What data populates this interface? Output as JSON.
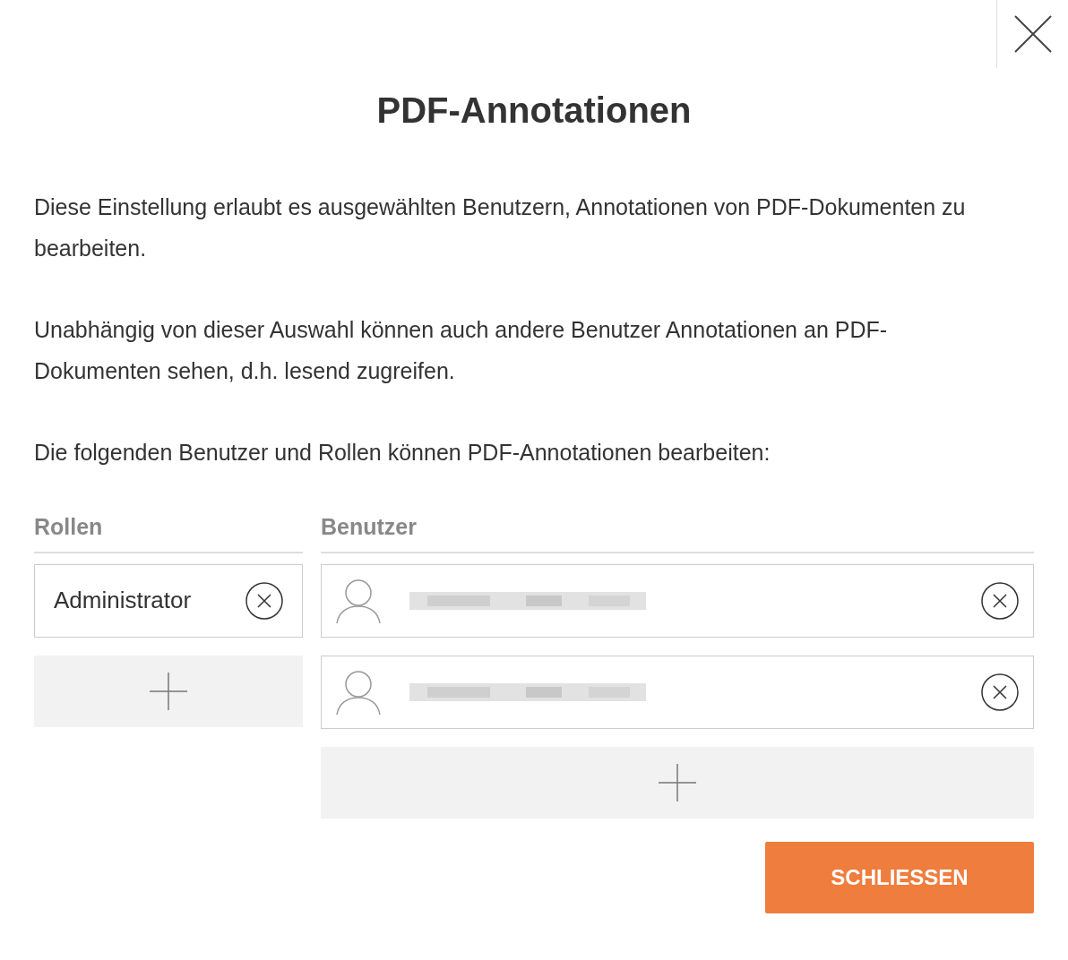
{
  "dialog": {
    "title": "PDF-Annotationen"
  },
  "paragraphs": [
    "Diese Einstellung erlaubt es ausgewählten Benutzern, Annotationen von PDF-Dokumenten zu bearbeiten.",
    "Unabhängig von dieser Auswahl können auch andere Benutzer Annotationen an PDF-Dokumenten sehen, d.h. lesend zugreifen.",
    "Die folgenden Benutzer und Rollen können PDF-Annotationen bearbeiten:"
  ],
  "roles": {
    "heading": "Rollen",
    "items": [
      {
        "name": "Administrator"
      }
    ]
  },
  "users": {
    "heading": "Benutzer",
    "items": [
      {
        "kind": "redacted"
      },
      {
        "kind": "redacted"
      }
    ]
  },
  "buttons": {
    "close": "SCHLIESSEN"
  }
}
